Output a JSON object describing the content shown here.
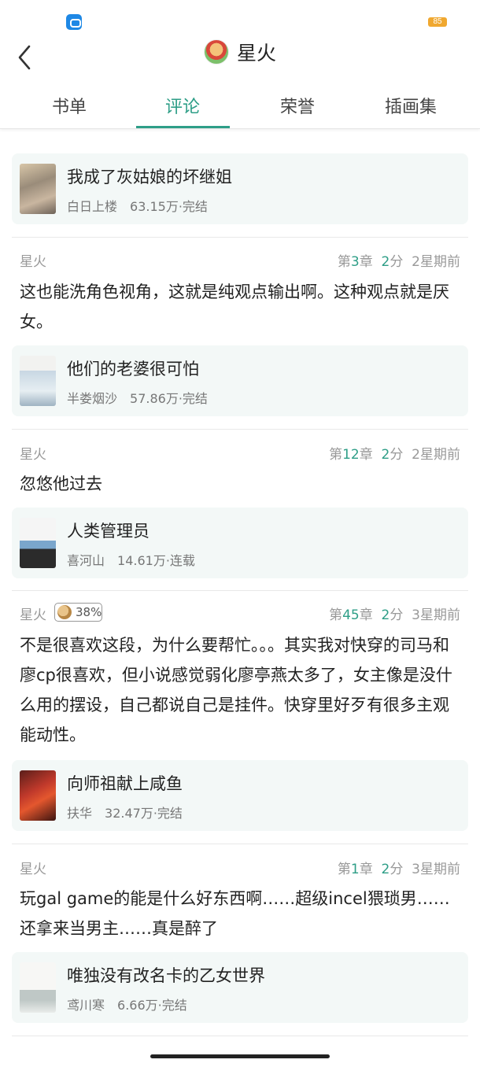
{
  "status_bar": {
    "battery": "85"
  },
  "header": {
    "title": "星火"
  },
  "tabs": [
    "书单",
    "评论",
    "荣誉",
    "插画集"
  ],
  "featured_book": {
    "title": "我成了灰姑娘的坏继姐",
    "author": "白日上楼",
    "info": "63.15万·完结"
  },
  "comments": [
    {
      "user": "星火",
      "chapter_prefix": "第",
      "chapter_num": "3",
      "chapter_suffix": "章",
      "score_num": "2",
      "score_suffix": "分",
      "time": "2星期前",
      "text": "这也能洗角色视角，这就是纯观点输出啊。这种观点就是厌女。",
      "book": {
        "title": "他们的老婆很可怕",
        "author": "半娄烟沙",
        "info": "57.86万·完结"
      }
    },
    {
      "user": "星火",
      "chapter_prefix": "第",
      "chapter_num": "12",
      "chapter_suffix": "章",
      "score_num": "2",
      "score_suffix": "分",
      "time": "2星期前",
      "text": "忽悠他过去",
      "book": {
        "title": "人类管理员",
        "author": "喜河山",
        "info": "14.61万·连载"
      }
    },
    {
      "user": "星火",
      "badge": "38%",
      "chapter_prefix": "第",
      "chapter_num": "45",
      "chapter_suffix": "章",
      "score_num": "2",
      "score_suffix": "分",
      "time": "3星期前",
      "text": "不是很喜欢这段，为什么要帮忙。。。其实我对快穿的司马和廖cp很喜欢，但小说感觉弱化廖亭燕太多了，女主像是没什么用的摆设，自己都说自己是挂件。快穿里好歹有很多主观能动性。",
      "book": {
        "title": "向师祖献上咸鱼",
        "author": "扶华",
        "info": "32.47万·完结"
      }
    },
    {
      "user": "星火",
      "chapter_prefix": "第",
      "chapter_num": "1",
      "chapter_suffix": "章",
      "score_num": "2",
      "score_suffix": "分",
      "time": "3星期前",
      "text": "玩gal game的能是什么好东西啊……超级incel猥琐男……还拿来当男主……真是醉了",
      "book": {
        "title": "唯独没有改名卡的乙女世界",
        "author": "鸢川寒",
        "info": "6.66万·完结"
      }
    }
  ]
}
